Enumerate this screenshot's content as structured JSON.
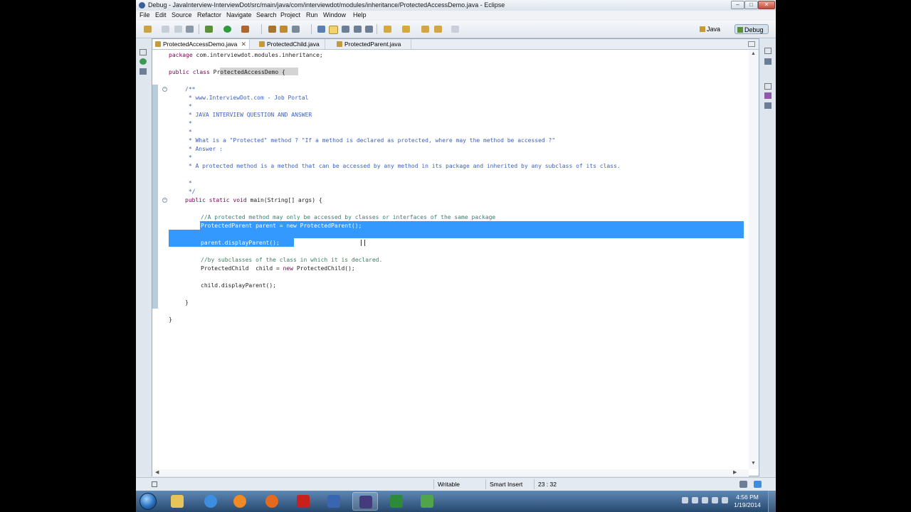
{
  "window": {
    "title": "Debug - JavaInterview-InterviewDot/src/main/java/com/interviewdot/modules/inheritance/ProtectedAccessDemo.java - Eclipse",
    "controls": {
      "minimize": "–",
      "maximize": "□",
      "close": "✕"
    }
  },
  "menu": [
    "File",
    "Edit",
    "Source",
    "Refactor",
    "Navigate",
    "Search",
    "Project",
    "Run",
    "Window",
    "Help"
  ],
  "perspectives": {
    "java": "Java",
    "debug": "Debug"
  },
  "editor": {
    "tabs": [
      {
        "label": "ProtectedAccessDemo.java",
        "active": true
      },
      {
        "label": "ProtectedChild.java",
        "active": false
      },
      {
        "label": "ProtectedParent.java",
        "active": false
      }
    ],
    "tab_close": "✕",
    "code": {
      "l01": {
        "kw": "package",
        "rest": " com.interviewdot.modules.inheritance;"
      },
      "l02": {
        "kw": "public class",
        "name": "ProtectedAccessDemo",
        "rest": " {"
      },
      "l03": "/**",
      "l04": " * www.InterviewDot.com - Job Portal",
      "l05": " *",
      "l06": " * JAVA INTERVIEW QUESTION AND ANSWER",
      "l07": " *",
      "l08": " *",
      "l09": " * What is a \"Protected\" method ? \"If a method is declared as protected, where may the method be accessed ?\"",
      "l10": " * Answer :",
      "l11": " *",
      "l12": " * A protected method is a method that can be accessed by any method in its package and inherited by any subclass of its class.",
      "l13": " *",
      "l14": " */",
      "l15": {
        "kw": "public static void",
        "rest": " main(String[] args) {"
      },
      "l16": "//A protected method may only be accessed by classes or interfaces of the same package",
      "l17": "ProtectedParent parent = new ProtectedParent();",
      "l18": "parent.displayParent();",
      "l19": "//by subclasses of the class in which it is declared.",
      "l20": {
        "a": "ProtectedChild  child = ",
        "kw": "new",
        "b": " ProtectedChild();"
      },
      "l21": "child.displayParent();",
      "l22": "}",
      "l23": "}"
    }
  },
  "status": {
    "writable": "Writable",
    "insert_mode": "Smart Insert",
    "cursor": "23 : 32"
  },
  "taskbar": {
    "clock_time": "4:56 PM",
    "clock_date": "1/19/2014",
    "apps": [
      {
        "name": "explorer",
        "color": "#e8c35a"
      },
      {
        "name": "ie",
        "color": "#3d8ee0"
      },
      {
        "name": "media-player",
        "color": "#f08a24"
      },
      {
        "name": "firefox",
        "color": "#e66a1e"
      },
      {
        "name": "acrobat",
        "color": "#c8201a"
      },
      {
        "name": "save-disk",
        "color": "#3a66b0"
      },
      {
        "name": "eclipse",
        "color": "#433b7c"
      },
      {
        "name": "terminal",
        "color": "#2c8a3a"
      },
      {
        "name": "task-app",
        "color": "#4fa548"
      }
    ]
  }
}
